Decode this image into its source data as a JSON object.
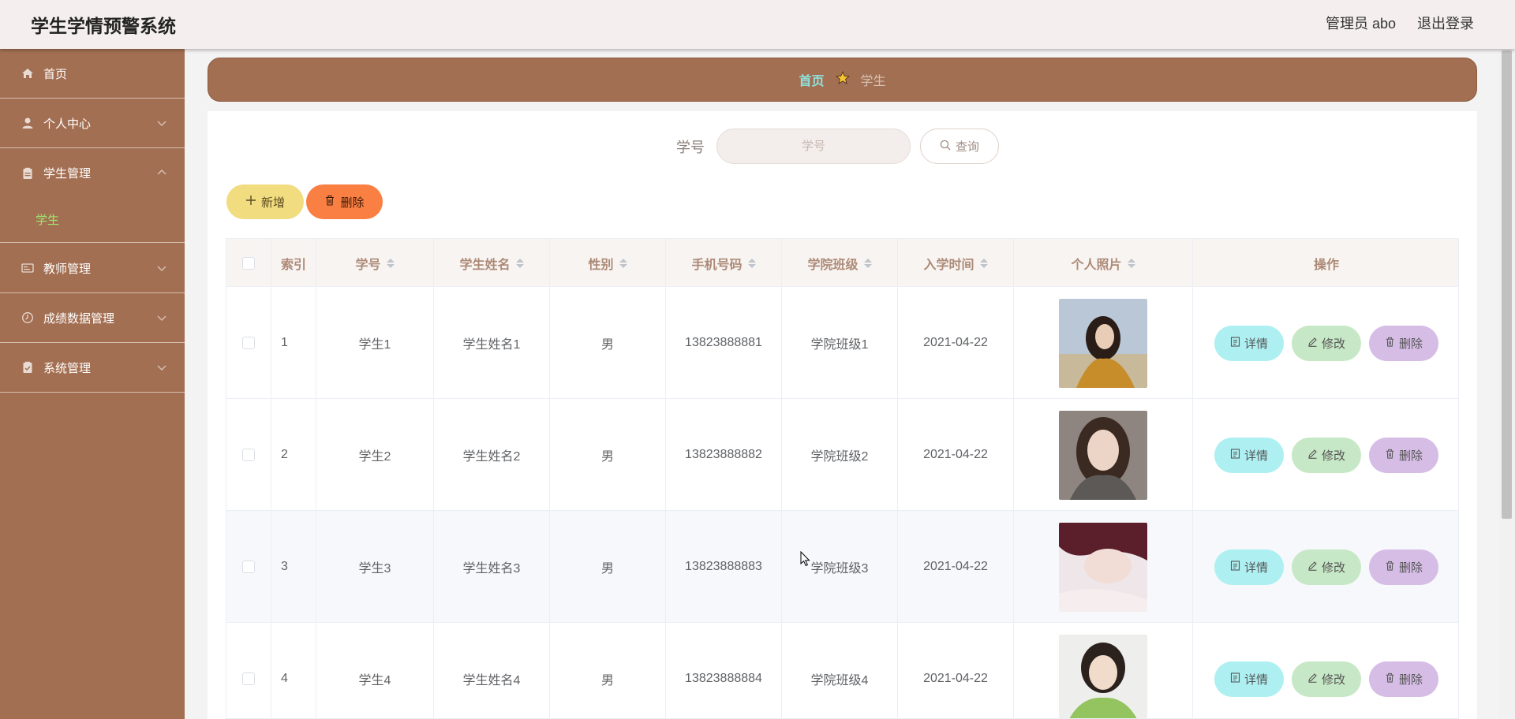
{
  "header": {
    "app_title": "学生学情预警系统",
    "user_label": "管理员 abo",
    "logout_label": "退出登录"
  },
  "sidebar": {
    "items": [
      {
        "label": "首页",
        "icon": "home-icon"
      },
      {
        "label": "个人中心",
        "icon": "user-icon"
      },
      {
        "label": "学生管理",
        "icon": "clipboard-icon",
        "expanded": true
      },
      {
        "label": "教师管理",
        "icon": "card-icon"
      },
      {
        "label": "成绩数据管理",
        "icon": "clock-icon"
      },
      {
        "label": "系统管理",
        "icon": "checklist-icon"
      }
    ],
    "active_sub_item": "学生"
  },
  "breadcrumb": {
    "home": "首页",
    "current": "学生"
  },
  "search": {
    "label": "学号",
    "placeholder": "学号",
    "query_label": "查询"
  },
  "toolbar": {
    "add_label": "新增",
    "delete_label": "删除"
  },
  "table": {
    "columns": [
      "索引",
      "学号",
      "学生姓名",
      "性别",
      "手机号码",
      "学院班级",
      "入学时间",
      "个人照片",
      "操作"
    ],
    "rows": [
      {
        "index": "1",
        "student_no": "学生1",
        "name": "学生姓名1",
        "gender": "男",
        "phone": "13823888881",
        "class": "学院班级1",
        "enroll_date": "2021-04-22"
      },
      {
        "index": "2",
        "student_no": "学生2",
        "name": "学生姓名2",
        "gender": "男",
        "phone": "13823888882",
        "class": "学院班级2",
        "enroll_date": "2021-04-22"
      },
      {
        "index": "3",
        "student_no": "学生3",
        "name": "学生姓名3",
        "gender": "男",
        "phone": "13823888883",
        "class": "学院班级3",
        "enroll_date": "2021-04-22"
      },
      {
        "index": "4",
        "student_no": "学生4",
        "name": "学生姓名4",
        "gender": "男",
        "phone": "13823888884",
        "class": "学院班级4",
        "enroll_date": "2021-04-22"
      }
    ],
    "actions": {
      "detail": "详情",
      "edit": "修改",
      "delete": "删除"
    }
  },
  "colors": {
    "sidebar": "#a36f52",
    "active_sub_item": "#9fe66f",
    "breadcrumb_home": "#8de3df",
    "add_button": "#f1dc80",
    "delete_button": "#fa7f43",
    "detail_button": "#aef0f2",
    "edit_button": "#c7e8c6",
    "remove_button": "#d6bde6"
  }
}
